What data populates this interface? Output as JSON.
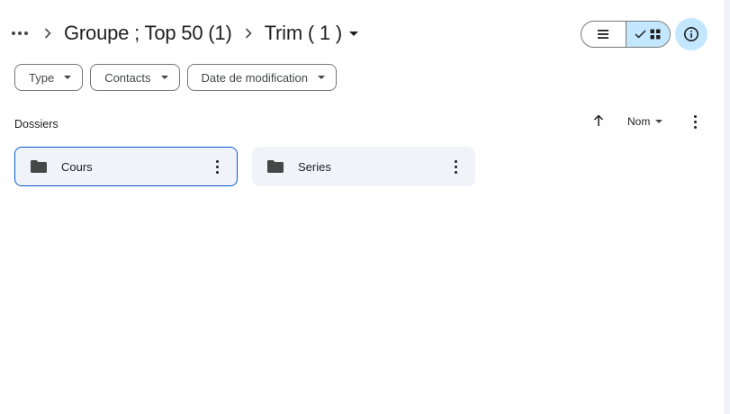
{
  "breadcrumb": {
    "overflow_icon": "more-horiz-icon",
    "separator": "›",
    "items": [
      {
        "label": "Groupe ; Top 50 (1)"
      },
      {
        "label": "Trim ( 1 )"
      }
    ]
  },
  "view_toggle": {
    "list_icon": "list-icon",
    "grid_icon": "grid-icon",
    "selected": "grid",
    "check_icon": "check-icon"
  },
  "info_button": {
    "icon": "info-icon"
  },
  "filters": [
    {
      "label": "Type"
    },
    {
      "label": "Contacts"
    },
    {
      "label": "Date de modification"
    }
  ],
  "section": {
    "title": "Dossiers"
  },
  "sort": {
    "label": "Nom",
    "direction": "ascending",
    "arrow_icon": "arrow-up-icon"
  },
  "folders": [
    {
      "label": "Cours",
      "selected": true,
      "icon": "folder-icon"
    },
    {
      "label": "Series",
      "selected": false,
      "icon": "folder-icon"
    }
  ],
  "colors": {
    "accent": "#0b57d0",
    "selected_bg": "#c2e7ff",
    "card_bg": "#f0f4f9",
    "border": "#747775",
    "text": "#1f1f1f"
  }
}
